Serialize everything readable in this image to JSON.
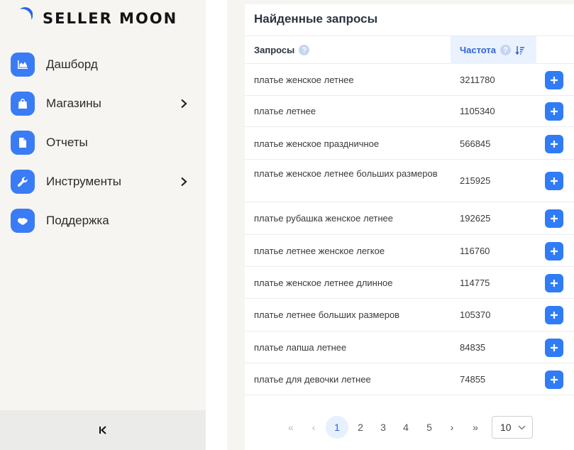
{
  "brand": {
    "name": "SELLER MOON"
  },
  "sidebar": {
    "items": [
      {
        "label": "Дашборд",
        "icon": "chart-area-icon",
        "has_submenu": false
      },
      {
        "label": "Магазины",
        "icon": "shopping-bag-icon",
        "has_submenu": true
      },
      {
        "label": "Отчеты",
        "icon": "file-icon",
        "has_submenu": false
      },
      {
        "label": "Инструменты",
        "icon": "wrench-icon",
        "has_submenu": true
      },
      {
        "label": "Поддержка",
        "icon": "handshake-icon",
        "has_submenu": false
      }
    ],
    "collapse_label": "K"
  },
  "card": {
    "title": "Найденные запросы",
    "columns": {
      "query": "Запросы",
      "frequency": "Частота"
    },
    "help_glyph": "?",
    "rows": [
      {
        "query": "платье женское летнее",
        "frequency": "3211780"
      },
      {
        "query": "платье летнее",
        "frequency": "1105340"
      },
      {
        "query": "платье женское праздничное",
        "frequency": "566845"
      },
      {
        "query": "платье женское летнее больших размеров",
        "frequency": "215925"
      },
      {
        "query": "платье рубашка женское летнее",
        "frequency": "192625"
      },
      {
        "query": "платье летнее женское легкое",
        "frequency": "116760"
      },
      {
        "query": "платье женское летнее длинное",
        "frequency": "114775"
      },
      {
        "query": "платье летнее больших размеров",
        "frequency": "105370"
      },
      {
        "query": "платье лапша летнее",
        "frequency": "84835"
      },
      {
        "query": "платье для девочки летнее",
        "frequency": "74855"
      }
    ]
  },
  "pagination": {
    "first": "«",
    "prev": "‹",
    "pages": [
      "1",
      "2",
      "3",
      "4",
      "5"
    ],
    "active_page": "1",
    "next": "›",
    "last": "»",
    "page_size": "10"
  },
  "colors": {
    "accent": "#3a7cf5",
    "button": "#2f7cf6",
    "header_highlight": "#eaf2ff"
  }
}
